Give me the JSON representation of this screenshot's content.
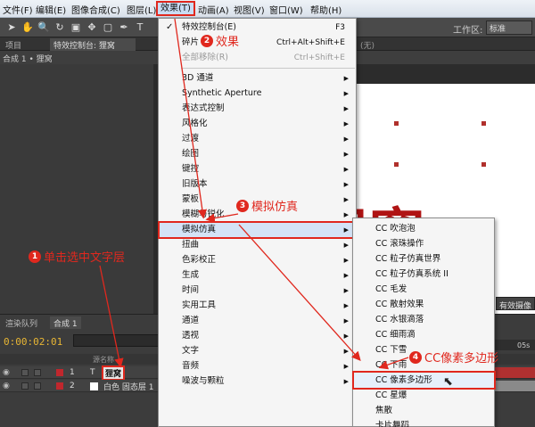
{
  "menubar": {
    "items": [
      "文件(F)",
      "编辑(E)",
      "图像合成(C)",
      "图层(L)",
      "效果(T)",
      "动画(A)",
      "视图(V)",
      "窗口(W)",
      "帮助(H)"
    ]
  },
  "toolbar": {
    "workspace_label": "工作区:",
    "workspace_value": "标准"
  },
  "panel_tabs": {
    "project": "项目",
    "effect_controls": "特效控制台: 狸窝",
    "right": "(无)"
  },
  "breadcrumb": "合成 1 • 狸窝",
  "viewer": {
    "text": "狸窝"
  },
  "right_panel_label": "有效摄像",
  "timeline": {
    "tab_render": "渲染队列",
    "tab_comp": "合成 1",
    "timecode": "0:00:02:01",
    "ruler_label": "05s",
    "header_label": "源名称",
    "layers": [
      {
        "num": "1",
        "type": "T",
        "name": "狸窝",
        "label_color": "#c0272d"
      },
      {
        "num": "2",
        "type": "",
        "name": "白色 固态层 1",
        "label_color": "#c0272d"
      }
    ]
  },
  "effect_menu": {
    "items": [
      {
        "label": "特效控制台(E)",
        "shortcut": "F3",
        "checked": true
      },
      {
        "label": "碎片",
        "shortcut": "Ctrl+Alt+Shift+E"
      },
      {
        "label": "全部移除(R)",
        "shortcut": "Ctrl+Shift+E",
        "disabled": true
      },
      {
        "label": "3D 通道",
        "submenu": true
      },
      {
        "label": "Synthetic Aperture",
        "submenu": true
      },
      {
        "label": "表达式控制",
        "submenu": true
      },
      {
        "label": "风格化",
        "submenu": true
      },
      {
        "label": "过渡",
        "submenu": true
      },
      {
        "label": "绘图",
        "submenu": true
      },
      {
        "label": "键控",
        "submenu": true
      },
      {
        "label": "旧版本",
        "submenu": true
      },
      {
        "label": "蒙板",
        "submenu": true
      },
      {
        "label": "模糊与锐化",
        "submenu": true
      },
      {
        "label": "模拟仿真",
        "submenu": true,
        "highlighted": true
      },
      {
        "label": "扭曲",
        "submenu": true
      },
      {
        "label": "色彩校正",
        "submenu": true
      },
      {
        "label": "生成",
        "submenu": true
      },
      {
        "label": "时间",
        "submenu": true
      },
      {
        "label": "实用工具",
        "submenu": true
      },
      {
        "label": "通道",
        "submenu": true
      },
      {
        "label": "透视",
        "submenu": true
      },
      {
        "label": "文字",
        "submenu": true
      },
      {
        "label": "音频",
        "submenu": true
      },
      {
        "label": "噪波与颗粒",
        "submenu": true
      }
    ]
  },
  "sub_menu": {
    "items": [
      {
        "label": "CC 吹泡泡"
      },
      {
        "label": "CC 滚珠操作"
      },
      {
        "label": "CC 粒子仿真世界"
      },
      {
        "label": "CC 粒子仿真系统 II"
      },
      {
        "label": "CC 毛发"
      },
      {
        "label": "CC 散射效果"
      },
      {
        "label": "CC 水银滴落"
      },
      {
        "label": "CC 细雨滴"
      },
      {
        "label": "CC 下雪"
      },
      {
        "label": "CC 下雨"
      },
      {
        "label": "CC 像素多边形",
        "highlighted": true
      },
      {
        "label": "CC 星爆"
      },
      {
        "label": "焦散"
      },
      {
        "label": "卡片舞蹈"
      }
    ]
  },
  "annotations": {
    "a1": {
      "num": "1",
      "text": "单击选中文字层"
    },
    "a2": {
      "num": "2",
      "text": "效果"
    },
    "a3": {
      "num": "3",
      "text": "模拟仿真"
    },
    "a4": {
      "num": "4",
      "text": "CC像素多边形"
    }
  },
  "colors": {
    "annotation_red": "#e0281e",
    "text_red": "#b01414",
    "menu_highlight": "#d4e3f6"
  }
}
